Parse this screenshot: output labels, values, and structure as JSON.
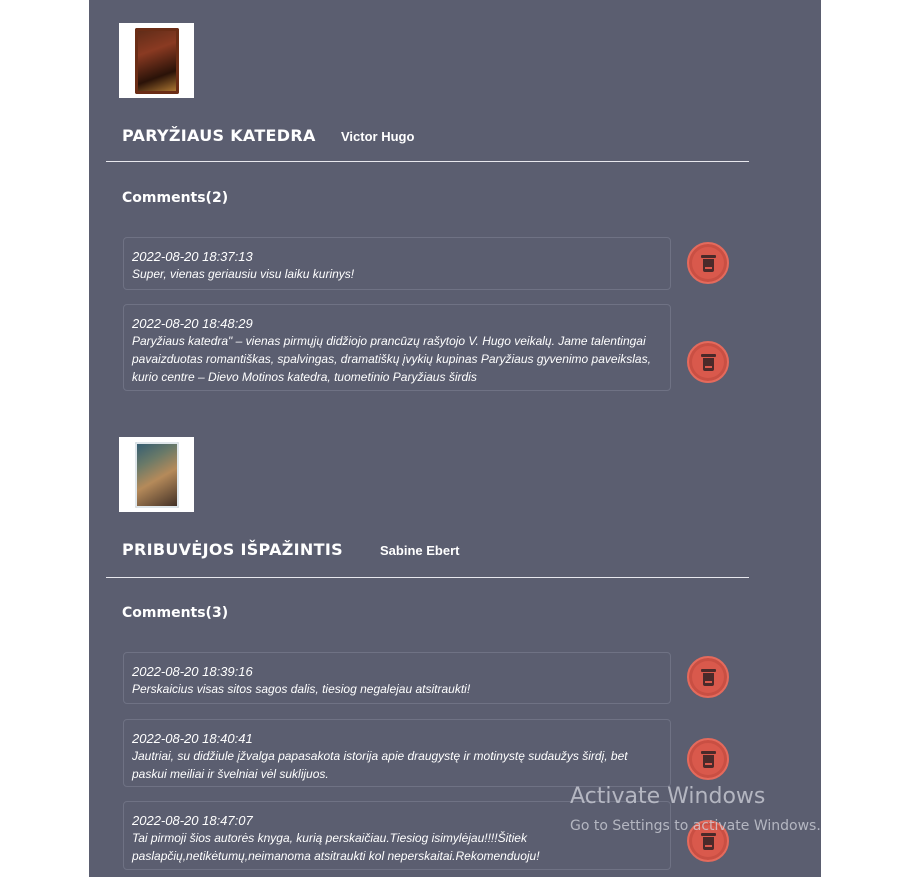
{
  "books": [
    {
      "title": "PARYŽIAUS KATEDRA",
      "author": "Victor Hugo",
      "cover_icon": "book-cover-image",
      "comments_heading": "Comments(2)",
      "comments": [
        {
          "timestamp": "2022-08-20 18:37:13",
          "text": "Super, vienas geriausiu visu laiku kurinys!"
        },
        {
          "timestamp": "2022-08-20 18:48:29",
          "text": "Paryžiaus katedra\" – vienas pirmųjų didžiojo prancūzų rašytojo V. Hugo veikalų. Jame talentingai pavaizduotas romantiškas, spalvingas, dramatiškų įvykių kupinas Paryžiaus gyvenimo paveikslas, kurio centre – Dievo Motinos katedra, tuometinio Paryžiaus širdis"
        }
      ]
    },
    {
      "title": "PRIBUVĖJOS IŠPAŽINTIS",
      "author": "Sabine Ebert",
      "cover_icon": "book-cover-image",
      "comments_heading": "Comments(3)",
      "comments": [
        {
          "timestamp": "2022-08-20 18:39:16",
          "text": "Perskaicius visas sitos sagos dalis, tiesiog negalejau atsitraukti!"
        },
        {
          "timestamp": "2022-08-20 18:40:41",
          "text": "Jautriai, su didžiule įžvalga papasakota istorija apie draugystę ir motinystę sudaužys širdį, bet paskui meiliai ir švelniai vėl suklijuos."
        },
        {
          "timestamp": "2022-08-20 18:47:07",
          "text": "Tai pirmoji šios autorės knyga, kurią perskaičiau.Tiesiog isimylėjau!!!!Šitiek paslapčių,netikėtumų,neimanoma atsitraukti kol neperskaitai.Rekomenduoju!"
        }
      ]
    }
  ],
  "delete_icon": "trash-icon",
  "colors": {
    "panel_bg": "#5b5e70",
    "delete_button": "#d9594c",
    "text": "#ffffff"
  },
  "watermark": {
    "title": "Activate Windows",
    "subtitle": "Go to Settings to activate Windows."
  }
}
